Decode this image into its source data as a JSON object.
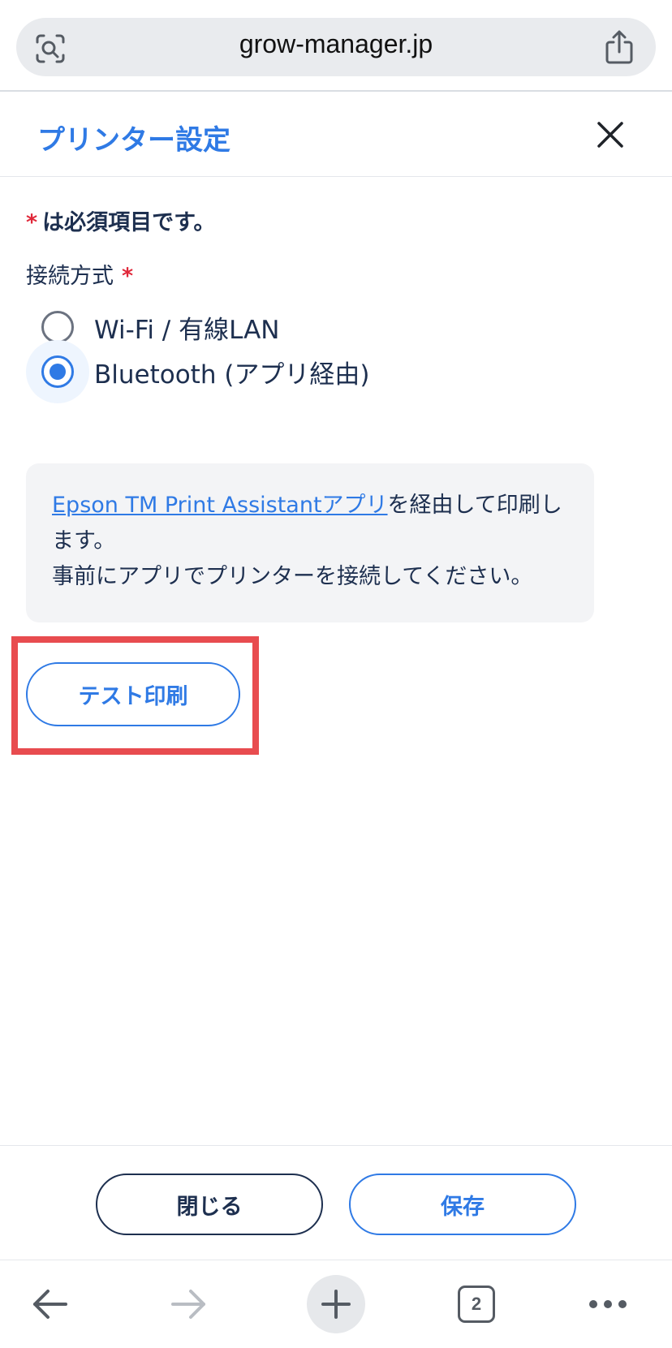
{
  "browser": {
    "url": "grow-manager.jp",
    "tab_count": "2"
  },
  "modal": {
    "title": "プリンター設定",
    "required_star": "*",
    "required_note": "は必須項目です。",
    "connection_label": "接続方式",
    "options": [
      {
        "label": "Wi-Fi / 有線LAN",
        "selected": false
      },
      {
        "label": "Bluetooth (アプリ経由)",
        "selected": true
      }
    ],
    "info": {
      "link_text": "Epson TM Print Assistantアプリ",
      "text_after_link": "を経由して印刷します。",
      "line2": "事前にアプリでプリンターを接続してください。"
    },
    "test_print_label": "テスト印刷",
    "close_label": "閉じる",
    "save_label": "保存"
  },
  "colors": {
    "accent": "#2f7ae5",
    "required": "#e0283a",
    "highlight": "#e84c4f",
    "text": "#1d2f4f"
  },
  "icons": [
    "visual-search-icon",
    "share-icon",
    "close-icon",
    "back-arrow-icon",
    "forward-arrow-icon",
    "plus-icon",
    "tabs-icon",
    "more-icon"
  ]
}
